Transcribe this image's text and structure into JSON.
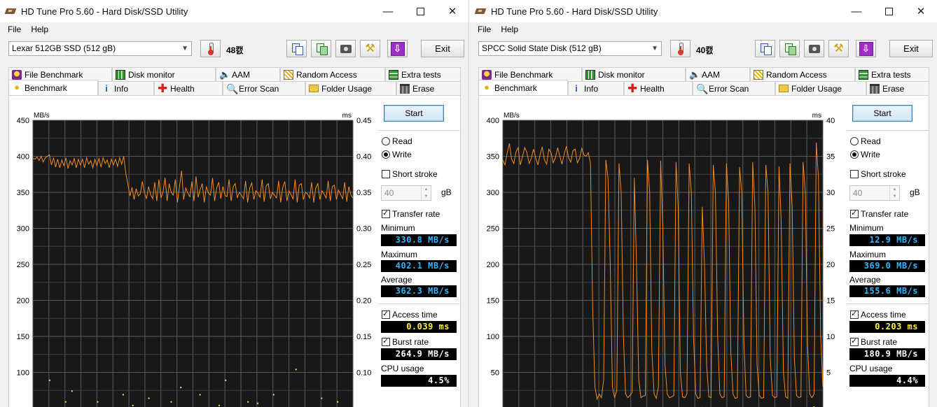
{
  "windows": [
    {
      "id": "left",
      "title": "HD Tune Pro 5.60 - Hard Disk/SSD Utility",
      "menu": {
        "file": "File",
        "help": "Help"
      },
      "drive": "Lexar 512GB SSD (512 gB)",
      "temperature": "48캜",
      "exit": "Exit",
      "tabs_top": [
        "File Benchmark",
        "Disk monitor",
        "AAM",
        "Random Access",
        "Extra tests"
      ],
      "tabs_bottom": [
        "Benchmark",
        "Info",
        "Health",
        "Error Scan",
        "Folder Usage",
        "Erase"
      ],
      "active_tab": "Benchmark",
      "start": "Start",
      "read_label": "Read",
      "write_label": "Write",
      "mode_selected": "write",
      "short_stroke": "Short stroke",
      "short_stroke_value": "40",
      "short_stroke_unit": "gB",
      "transfer_rate": "Transfer rate",
      "minimum_label": "Minimum",
      "minimum": "330.8 MB/s",
      "maximum_label": "Maximum",
      "maximum": "402.1 MB/s",
      "average_label": "Average",
      "average": "362.3 MB/s",
      "access_time_label": "Access time",
      "access_time": "0.039 ms",
      "burst_rate_label": "Burst rate",
      "burst_rate": "264.9 MB/s",
      "cpu_usage_label": "CPU usage",
      "cpu_usage": "4.5%"
    },
    {
      "id": "right",
      "title": "HD Tune Pro 5.60 - Hard Disk/SSD Utility",
      "menu": {
        "file": "File",
        "help": "Help"
      },
      "drive": "SPCC Solid State Disk (512 gB)",
      "temperature": "40캜",
      "exit": "Exit",
      "tabs_top": [
        "File Benchmark",
        "Disk monitor",
        "AAM",
        "Random Access",
        "Extra tests"
      ],
      "tabs_bottom": [
        "Benchmark",
        "Info",
        "Health",
        "Error Scan",
        "Folder Usage",
        "Erase"
      ],
      "active_tab": "Benchmark",
      "start": "Start",
      "read_label": "Read",
      "write_label": "Write",
      "mode_selected": "write",
      "short_stroke": "Short stroke",
      "short_stroke_value": "40",
      "short_stroke_unit": "gB",
      "transfer_rate": "Transfer rate",
      "minimum_label": "Minimum",
      "minimum": "12.9 MB/s",
      "maximum_label": "Maximum",
      "maximum": "369.0 MB/s",
      "average_label": "Average",
      "average": "155.6 MB/s",
      "access_time_label": "Access time",
      "access_time": "0.203 ms",
      "burst_rate_label": "Burst rate",
      "burst_rate": "180.9 MB/s",
      "cpu_usage_label": "CPU usage",
      "cpu_usage": "4.4%"
    }
  ],
  "colors": {
    "graph_bg": "#181818",
    "grid": "#5a5a5a",
    "series": "#f08a24",
    "access_points": "#e8e83a"
  },
  "chart_data": [
    {
      "type": "line",
      "xlabel": "",
      "y_left_label": "MB/s",
      "y_right_label": "ms",
      "y_left_ticks": [
        450,
        400,
        350,
        300,
        250,
        200,
        150,
        100
      ],
      "y_right_ticks": [
        "0.45",
        "0.40",
        "0.35",
        "0.30",
        "0.25",
        "0.20",
        "0.15",
        "0.10"
      ],
      "ylim": [
        50,
        450
      ],
      "ylim_right": [
        0.05,
        0.45
      ],
      "grid": true,
      "series": [
        {
          "values": [
            397,
            396,
            399,
            394,
            400,
            392,
            398,
            400,
            402,
            388,
            398,
            385,
            396,
            384,
            395,
            387,
            398,
            383,
            394,
            388,
            397,
            384,
            396,
            388,
            396,
            384,
            398,
            389,
            394,
            384,
            396,
            387,
            397,
            385,
            398,
            390,
            395,
            384,
            396,
            388,
            396,
            386,
            398,
            389,
            400,
            376,
            361,
            345,
            357,
            340,
            355,
            345,
            348,
            365,
            350,
            341,
            358,
            347,
            341,
            364,
            338,
            368,
            342,
            350,
            370,
            338,
            362,
            350,
            346,
            368,
            336,
            358,
            380,
            340,
            356,
            349,
            344,
            365,
            338,
            372,
            343,
            354,
            362,
            336,
            358,
            349,
            346,
            370,
            338,
            356,
            364,
            341,
            358,
            346,
            344,
            368,
            338,
            358,
            362,
            342,
            350,
            346,
            341,
            366,
            336,
            356,
            363,
            340,
            352,
            349,
            343,
            368,
            337,
            359,
            362,
            341,
            350,
            346,
            342,
            366,
            336,
            357,
            365,
            338,
            352,
            347,
            341,
            368,
            336,
            360,
            362,
            340,
            350,
            348,
            342,
            364,
            336,
            356,
            362,
            340,
            352,
            348,
            342,
            366,
            338,
            358,
            360,
            340,
            353,
            347,
            341,
            364,
            337,
            358,
            346,
            342
          ]
        }
      ],
      "access_points": [
        [
          0.05,
          0.09
        ],
        [
          0.12,
          0.075
        ],
        [
          0.2,
          0.06
        ],
        [
          0.28,
          0.07
        ],
        [
          0.36,
          0.065
        ],
        [
          0.43,
          0.06
        ],
        [
          0.52,
          0.07
        ],
        [
          0.6,
          0.09
        ],
        [
          0.67,
          0.06
        ],
        [
          0.75,
          0.07
        ],
        [
          0.82,
          0.105
        ],
        [
          0.9,
          0.065
        ],
        [
          0.1,
          0.06
        ],
        [
          0.46,
          0.08
        ],
        [
          0.31,
          0.055
        ],
        [
          0.58,
          0.055
        ],
        [
          0.7,
          0.058
        ],
        [
          0.95,
          0.06
        ]
      ]
    },
    {
      "type": "line",
      "xlabel": "",
      "y_left_label": "MB/s",
      "y_right_label": "ms",
      "y_left_ticks": [
        400,
        350,
        300,
        250,
        200,
        150,
        100,
        50
      ],
      "y_right_ticks": [
        "40",
        "35",
        "30",
        "25",
        "20",
        "15",
        "10",
        "5"
      ],
      "ylim": [
        50,
        400
      ],
      "ylim_right": [
        5,
        40
      ],
      "grid": true,
      "series": [
        {
          "values": [
            345,
            338,
            355,
            368,
            346,
            340,
            356,
            362,
            338,
            350,
            362,
            355,
            340,
            347,
            360,
            348,
            338,
            352,
            363,
            345,
            339,
            360,
            355,
            341,
            348,
            362,
            350,
            339,
            353,
            364,
            348,
            342,
            358,
            360,
            341,
            347,
            361,
            352,
            350,
            355,
            340,
            140,
            30,
            12.9,
            20,
            15,
            40,
            345,
            320,
            200,
            30,
            15,
            25,
            340,
            300,
            100,
            20,
            15,
            18,
            22,
            320,
            200,
            40,
            15,
            17,
            18,
            345,
            300,
            80,
            20,
            14,
            30,
            344,
            250,
            60,
            20,
            15,
            16,
            18,
            342,
            280,
            50,
            16,
            15,
            20,
            340,
            300,
            100,
            20,
            14,
            15,
            280,
            200,
            60,
            16,
            15,
            338,
            300,
            100,
            20,
            15,
            16,
            340,
            290,
            80,
            20,
            14,
            15,
            335,
            300,
            90,
            18,
            15,
            16,
            342,
            280,
            60,
            18,
            14,
            15,
            338,
            300,
            70,
            18,
            15,
            16,
            336,
            260,
            50,
            16,
            14,
            340,
            280,
            70,
            18,
            15,
            16,
            342,
            300,
            90,
            20,
            15,
            20,
            369,
            320,
            100,
            30
          ]
        }
      ],
      "access_points": [
        [
          0.62,
          0.21
        ],
        [
          0.97,
          0.29
        ]
      ]
    }
  ]
}
